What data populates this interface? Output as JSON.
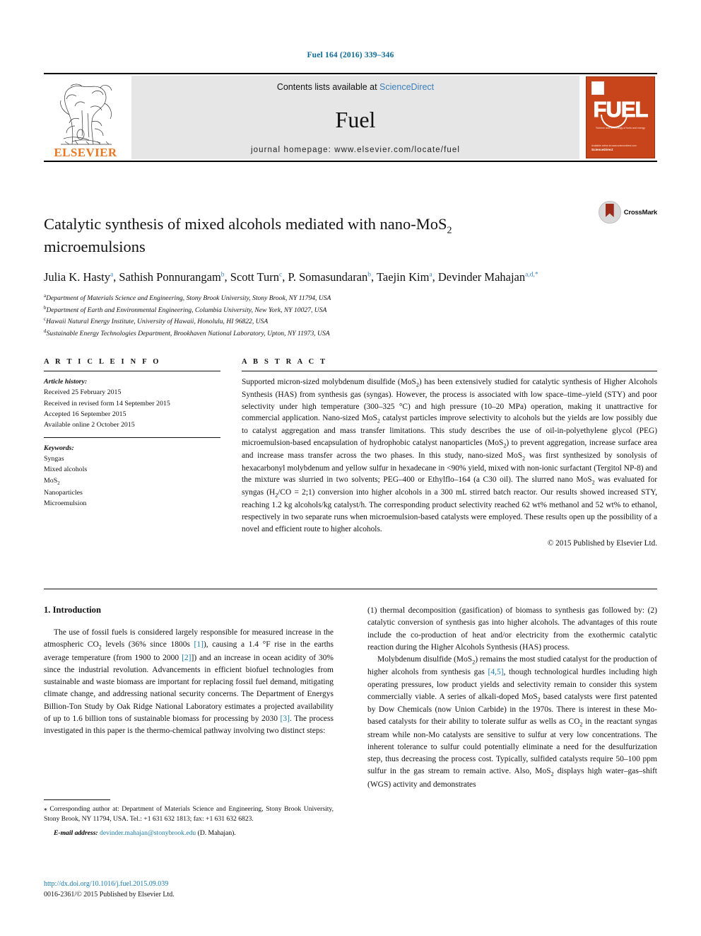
{
  "running_head": "Fuel 164 (2016) 339–346",
  "masthead": {
    "contents_prefix": "Contents lists available at ",
    "sciencedirect": "ScienceDirect",
    "journal_name": "Fuel",
    "homepage": "journal homepage: www.elsevier.com/locate/fuel",
    "publisher_wordmark": "ELSEVIER",
    "publisher_logo": "elsevier-tree-logo",
    "cover": {
      "wordmark": "FUEL",
      "subtitle": "Science and technology of fuels and energy",
      "footer_line1": "Available online at www.sciencedirect.com",
      "footer_line2": "ScienceDirect"
    }
  },
  "article": {
    "title_part1": "Catalytic synthesis of mixed alcohols mediated with nano-MoS",
    "title_sub": "2",
    "title_part2": "microemulsions",
    "crossmark_label": "CrossMark",
    "authors": [
      {
        "name": "Julia K. Hasty",
        "sup": "a",
        "sep": ", "
      },
      {
        "name": "Sathish Ponnurangam",
        "sup": "b",
        "sep": ", "
      },
      {
        "name": "Scott Turn",
        "sup": "c",
        "sep": ", "
      },
      {
        "name": "P. Somasundaran",
        "sup": "b",
        "sep": ", "
      },
      {
        "name": "Taejin Kim",
        "sup": "a",
        "sep": ", "
      },
      {
        "name": "Devinder Mahajan",
        "sup": "a,d,*",
        "sep": ""
      }
    ],
    "affiliations": [
      {
        "mark": "a",
        "text": "Department of Materials Science and Engineering, Stony Brook University, Stony Brook, NY 11794, USA"
      },
      {
        "mark": "b",
        "text": "Department of Earth and Environmental Engineering, Columbia University, New York, NY 10027, USA"
      },
      {
        "mark": "c",
        "text": "Hawaii Natural Energy Institute, University of Hawaii, Honolulu, HI 96822, USA"
      },
      {
        "mark": "d",
        "text": "Sustainable Energy Technologies Department, Brookhaven National Laboratory, Upton, NY 11973, USA"
      }
    ]
  },
  "article_info": {
    "heading": "A R T I C L E   I N F O",
    "history_label": "Article history:",
    "history": [
      "Received 25 February 2015",
      "Received in revised form 14 September 2015",
      "Accepted 16 September 2015",
      "Available online 2 October 2015"
    ],
    "keywords_label": "Keywords:",
    "keywords": [
      "Syngas",
      "Mixed alcohols",
      "MoS2",
      "Nanoparticles",
      "Microemulsion"
    ]
  },
  "abstract": {
    "heading": "A B S T R A C T",
    "p1_a": "Supported micron-sized molybdenum disulfide (MoS",
    "p1_b": ") has been extensively studied for catalytic synthesis of Higher Alcohols Synthesis (HAS) from synthesis gas (syngas). However, the process is associated with low space–time–yield (STY) and poor selectivity under high temperature (300–325 °C) and high pressure (10–20 MPa) operation, making it unattractive for commercial application. Nano-sized MoS",
    "p1_c": " catalyst particles improve selectivity to alcohols but the yields are low possibly due to catalyst aggregation and mass transfer limitations. This study describes the use of oil-in-polyethylene glycol (PEG) microemulsion-based encapsulation of hydrophobic catalyst nanoparticles (MoS",
    "p1_d": ") to prevent aggregation, increase surface area and increase mass transfer across the two phases. In this study, nano-sized MoS",
    "p1_e": " was first synthesized by sonolysis of hexacarbonyl molybdenum and yellow sulfur in hexadecane in <90% yield, mixed with non-ionic surfactant (Tergitol NP-8) and the mixture was slurried in two solvents; PEG–400 or Ethylflo–164 (a C30 oil). The slurred nano MoS",
    "p1_f": " was evaluated for syngas (H",
    "p1_g": "/CO = 2;1) conversion into higher alcohols in a 300 mL stirred batch reactor. Our results showed increased STY, reaching 1.2 kg alcohols/kg catalyst/h. The corresponding product selectivity reached 62 wt% methanol and 52 wt% to ethanol, respectively in two separate runs when microemulsion-based catalysts were employed. These results open up the possibility of a novel and efficient route to higher alcohols.",
    "copyright": "© 2015 Published by Elsevier Ltd."
  },
  "introduction": {
    "heading": "1. Introduction",
    "left_p1_a": "The use of fossil fuels is considered largely responsible for measured increase in the atmospheric CO",
    "left_p1_b": " levels (36% since 1800s ",
    "left_ref1": "[1]",
    "left_p1_c": "), causing a 1.4 °F rise in the earths average temperature (from 1900 to 2000 ",
    "left_ref2": "[2]",
    "left_p1_d": "]) and an increase in ocean acidity of 30% since the industrial revolution. Advancements in efficient biofuel technologies from sustainable and waste biomass are important for replacing fossil fuel demand, mitigating climate change, and addressing national security concerns. The Department of Energys Billion-Ton Study by Oak Ridge National Laboratory estimates a projected availability of up to 1.6 billion tons of sustainable biomass for processing by 2030 ",
    "left_ref3": "[3]",
    "left_p1_e": ". The process investigated in this paper is the thermo-chemical pathway involving two distinct steps:",
    "right_p1": "(1) thermal decomposition (gasification) of biomass to synthesis gas followed by: (2) catalytic conversion of synthesis gas into higher alcohols. The advantages of this route include the co-production of heat and/or electricity from the exothermic catalytic reaction during the Higher Alcohols Synthesis (HAS) process.",
    "right_p2_a": "Molybdenum disulfide (MoS",
    "right_p2_b": ") remains the most studied catalyst for the production of higher alcohols from synthesis gas ",
    "right_ref45": "[4,5]",
    "right_p2_c": ", though technological hurdles including high operating pressures, low product yields and selectivity remain to consider this system commercially viable. A series of alkali-doped MoS",
    "right_p2_d": " based catalysts were first patented by Dow Chemicals (now Union Carbide) in the 1970s. There is interest in these Mo-based catalysts for their ability to tolerate sulfur as wells as CO",
    "right_p2_e": " in the reactant syngas stream while non-Mo catalysts are sensitive to sulfur at very low concentrations. The inherent tolerance to sulfur could potentially eliminate a need for the desulfurization step, thus decreasing the process cost. Typically, sulfided catalysts require 50–100 ppm sulfur in the gas stream to remain active. Also, MoS",
    "right_p2_f": " displays high water–gas–shift (WGS) activity and demonstrates"
  },
  "footnotes": {
    "corresponding_marker": "⁎",
    "corresponding": " Corresponding author at: Department of Materials Science and Engineering, Stony Brook University, Stony Brook, NY 11794, USA. Tel.: +1 631 632 1813; fax: +1 631 632 6823.",
    "email_label": "E-mail address:",
    "email": "devinder.mahajan@stonybrook.edu",
    "email_suffix": " (D. Mahajan).",
    "doi": "http://dx.doi.org/10.1016/j.fuel.2015.09.039",
    "issn": "0016-2361/© 2015 Published by Elsevier Ltd."
  },
  "colors": {
    "link": "#1a7aa8",
    "running_head": "#0b6a94",
    "elsevier_orange": "#E87722",
    "cover_orange": "#C8441B"
  }
}
